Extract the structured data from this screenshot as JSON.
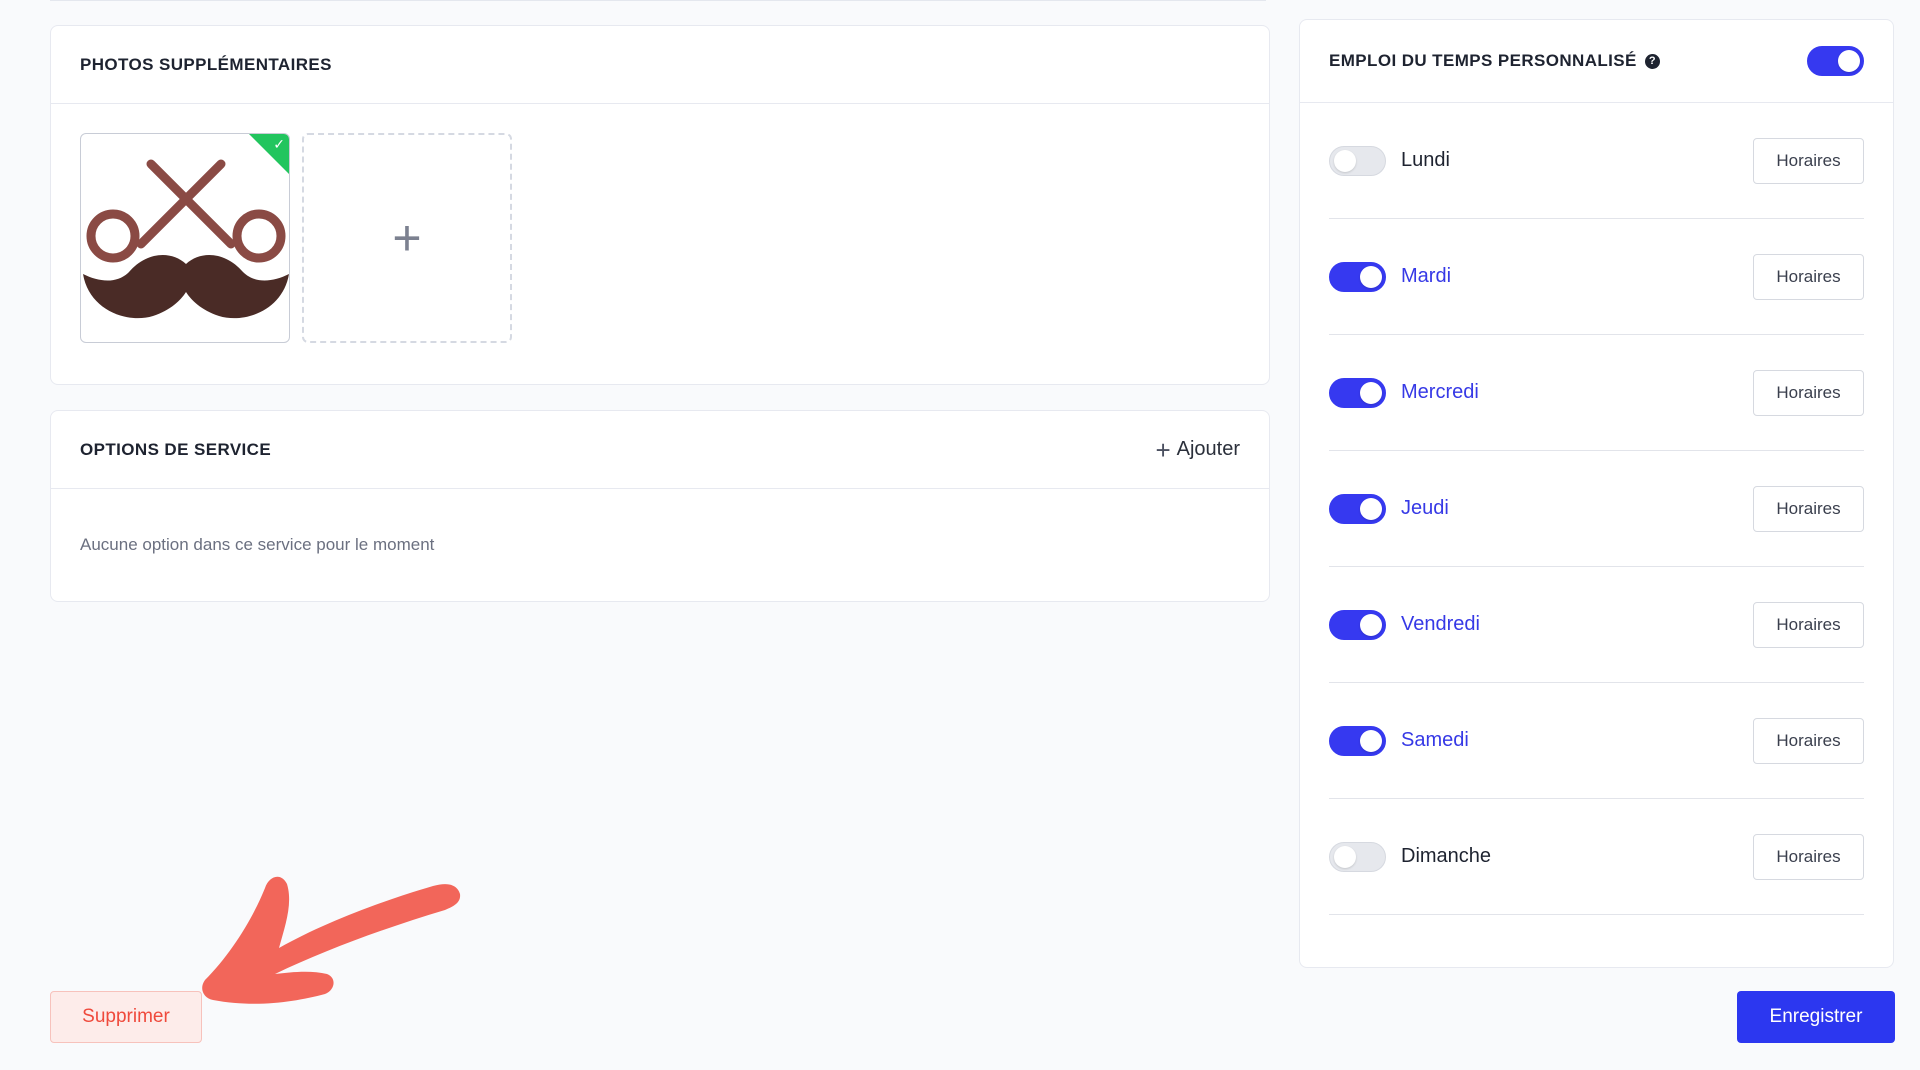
{
  "photos": {
    "title": "PHOTOS SUPPLÉMENTAIRES",
    "add_symbol": "+",
    "check_symbol": "✓"
  },
  "options": {
    "title": "OPTIONS DE SERVICE",
    "add_label": "Ajouter",
    "add_symbol": "+",
    "empty_text": "Aucune option dans ce service pour le moment"
  },
  "schedule": {
    "title": "EMPLOI DU TEMPS PERSONNALISÉ",
    "help_symbol": "?",
    "enabled": true,
    "days": [
      {
        "name": "Lundi",
        "enabled": false,
        "button": "Horaires"
      },
      {
        "name": "Mardi",
        "enabled": true,
        "button": "Horaires"
      },
      {
        "name": "Mercredi",
        "enabled": true,
        "button": "Horaires"
      },
      {
        "name": "Jeudi",
        "enabled": true,
        "button": "Horaires"
      },
      {
        "name": "Vendredi",
        "enabled": true,
        "button": "Horaires"
      },
      {
        "name": "Samedi",
        "enabled": true,
        "button": "Horaires"
      },
      {
        "name": "Dimanche",
        "enabled": false,
        "button": "Horaires"
      }
    ]
  },
  "actions": {
    "delete_label": "Supprimer",
    "save_label": "Enregistrer"
  },
  "colors": {
    "accent": "#3639f0",
    "danger": "#ef4a3c",
    "success": "#22c55e",
    "annotation_arrow": "#f2665a"
  },
  "icons": {
    "photo": "scissors-mustache-logo",
    "add_photo": "plus-icon",
    "help": "question-circle-icon",
    "annotation": "red-arrow-annotation"
  }
}
